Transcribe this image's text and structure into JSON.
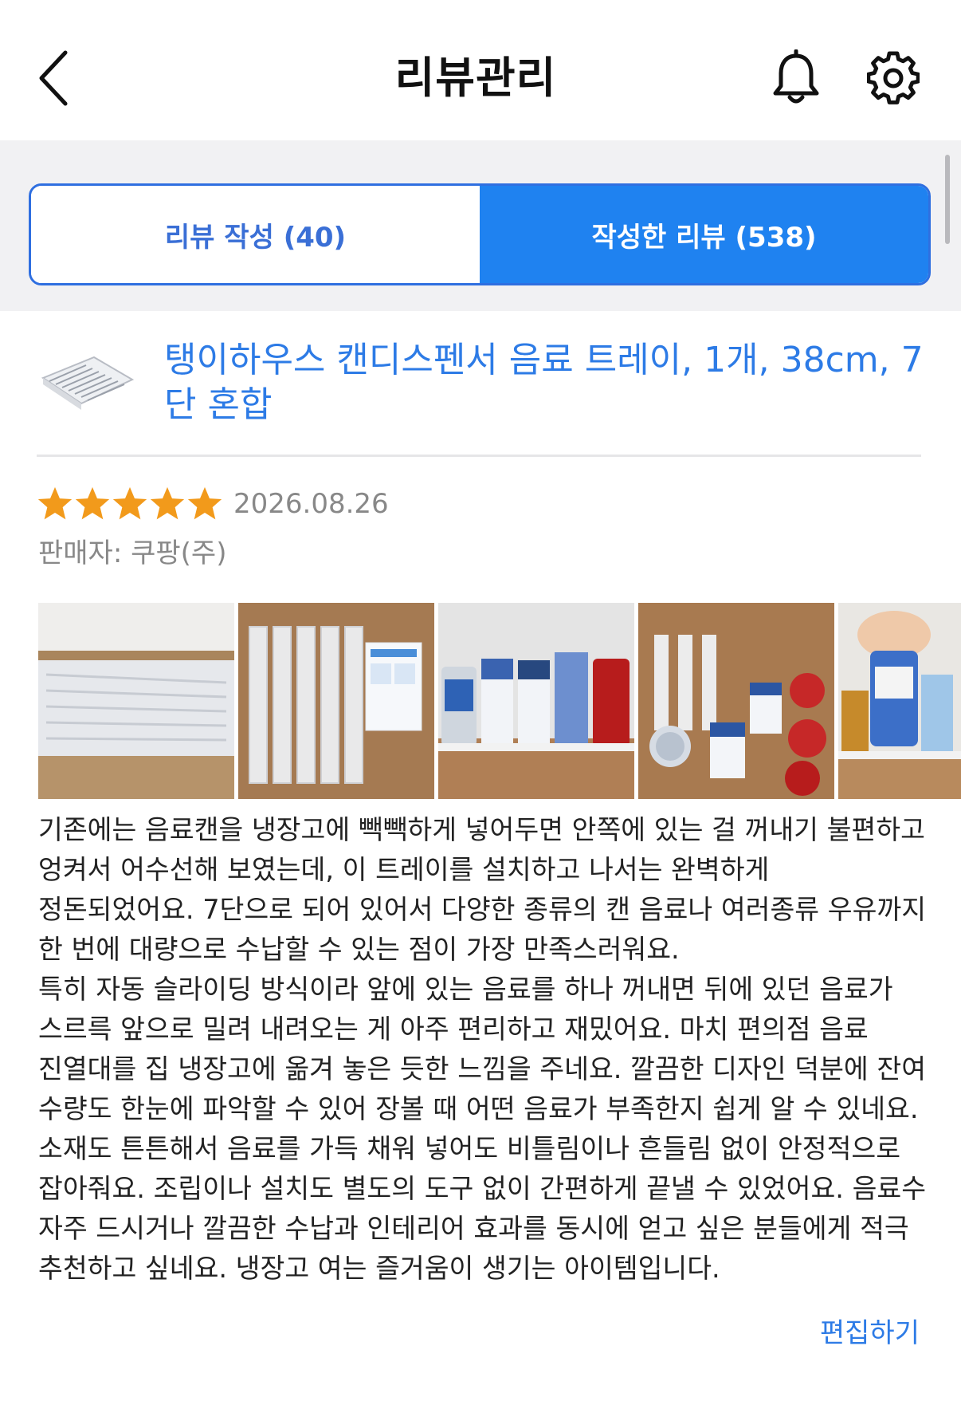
{
  "header": {
    "title": "리뷰관리",
    "icons": [
      "chevron-left-icon",
      "bell-icon",
      "gear-icon"
    ]
  },
  "tabs": [
    {
      "label": "리뷰 작성 (40)",
      "active": false
    },
    {
      "label": "작성한 리뷰 (538)",
      "active": true
    }
  ],
  "product": {
    "name": "탱이하우스 캔디스펜서 음료 트레이, 1개, 38cm, 7단 혼합"
  },
  "review": {
    "rating": 5,
    "rating_max": 5,
    "date": "2026.08.26",
    "seller": "판매자: 쿠팡(주)",
    "photo_count_visible": 5,
    "paragraphs": [
      "기존에는 음료캔을 냉장고에 빽빽하게 넣어두면 안쪽에 있는 걸 꺼내기 불편하고 엉켜서 어수선해 보였는데, 이 트레이를 설치하고 나서는 완벽하게 정돈되었어요. 7단으로 되어 있어서 다양한 종류의 캔 음료나 여러종류 우유까지 한 번에 대량으로 수납할 수 있는 점이 가장 만족스러워요.",
      "특히 자동 슬라이딩 방식이라 앞에 있는 음료를 하나 꺼내면 뒤에 있던 음료가 스르륵 앞으로 밀려 내려오는 게 아주 편리하고 재밌어요. 마치 편의점 음료 진열대를 집 냉장고에 옮겨 놓은 듯한 느낌을 주네요. 깔끔한 디자인 덕분에 잔여 수량도 한눈에 파악할 수 있어 장볼 때 어떤 음료가 부족한지 쉽게 알 수 있네요. 소재도 튼튼해서 음료를 가득 채워 넣어도 비틀림이나 흔들림 없이 안정적으로 잡아줘요. 조립이나 설치도 별도의 도구 없이 간편하게 끝낼 수 있었어요. 음료수 자주 드시거나 깔끔한 수납과 인테리어 효과를 동시에 얻고 싶은 분들에게 적극 추천하고 싶네요. 냉장고 여는 즐거움이 생기는 아이템입니다."
    ],
    "edit_label": "편집하기"
  },
  "colors": {
    "accent": "#1f82f0",
    "link": "#2d7be6",
    "star": "#f29a1b",
    "muted": "#888888"
  }
}
